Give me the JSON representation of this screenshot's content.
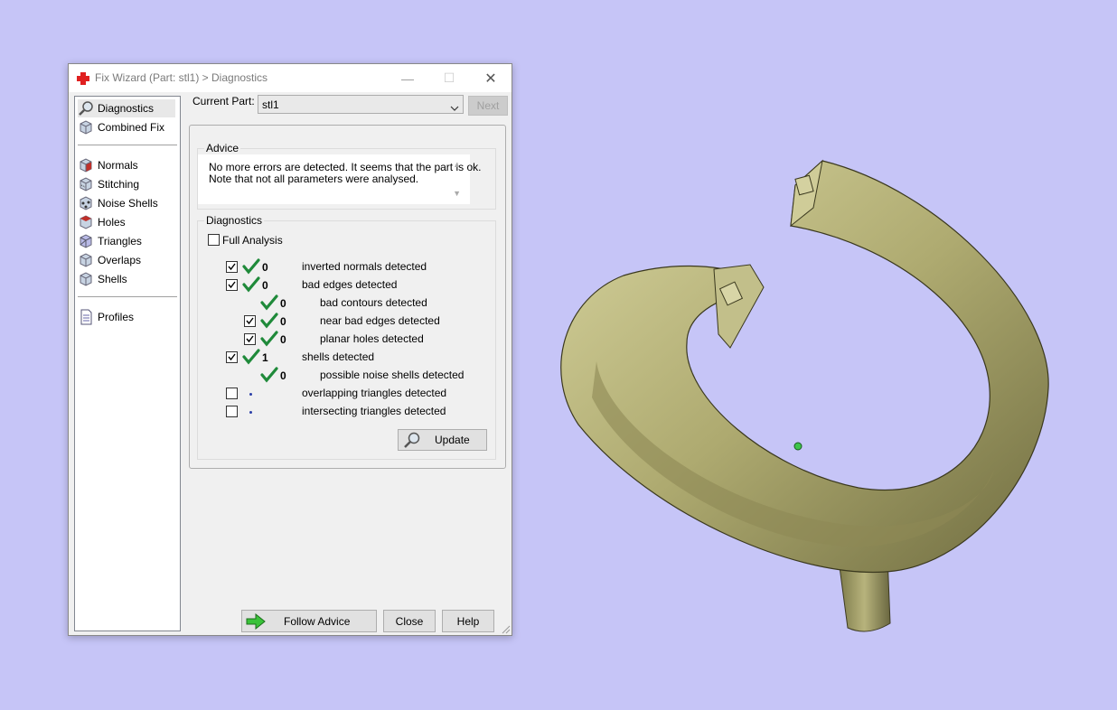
{
  "window": {
    "title": "Fix Wizard (Part: stl1) > Diagnostics",
    "minimize": "—",
    "maximize": "☐",
    "close": "✕"
  },
  "sidebar": {
    "items": [
      {
        "label": "Diagnostics",
        "icon": "magnifier-icon",
        "selected": true
      },
      {
        "label": "Combined Fix",
        "icon": "cube-icon"
      },
      {
        "label": "Normals",
        "icon": "normals-cube-icon"
      },
      {
        "label": "Stitching",
        "icon": "stitching-cube-icon"
      },
      {
        "label": "Noise Shells",
        "icon": "noise-shells-icon"
      },
      {
        "label": "Holes",
        "icon": "holes-cube-icon"
      },
      {
        "label": "Triangles",
        "icon": "triangles-cube-icon"
      },
      {
        "label": "Overlaps",
        "icon": "overlaps-cube-icon"
      },
      {
        "label": "Shells",
        "icon": "shells-cube-icon"
      },
      {
        "label": "Profiles",
        "icon": "document-icon"
      }
    ]
  },
  "part": {
    "label": "Current Part:",
    "value": "stl1",
    "next_label": "Next"
  },
  "advice": {
    "title": "Advice",
    "line1": "No more errors are detected. It seems that the part is ok.",
    "line2": "Note that not all parameters were analysed."
  },
  "diagnostics": {
    "title": "Diagnostics",
    "full_analysis_label": "Full Analysis",
    "full_analysis_checked": false,
    "rows": [
      {
        "text": "inverted normals detected",
        "count": "0",
        "checked": true,
        "status": "ok"
      },
      {
        "text": "bad edges detected",
        "count": "0",
        "checked": true,
        "status": "ok"
      },
      {
        "text": "bad contours detected",
        "count": "0",
        "status": "ok"
      },
      {
        "text": "near bad edges detected",
        "count": "0",
        "checked": true,
        "status": "ok"
      },
      {
        "text": "planar holes detected",
        "count": "0",
        "checked": true,
        "status": "ok"
      },
      {
        "text": "shells detected",
        "count": "1",
        "checked": true,
        "status": "ok"
      },
      {
        "text": "possible noise shells detected",
        "count": "0",
        "status": "ok"
      },
      {
        "text": "overlapping triangles detected",
        "checked": false,
        "status": "not-analysed"
      },
      {
        "text": "intersecting triangles detected",
        "checked": false,
        "status": "not-analysed"
      }
    ],
    "update_label": "Update"
  },
  "footer": {
    "follow_advice_label": "Follow Advice",
    "close_label": "Close",
    "help_label": "Help"
  },
  "colors": {
    "viewport_bg": "#c6c5f7",
    "model_color": "#b8b47c",
    "check_green": "#1f8a3a"
  }
}
